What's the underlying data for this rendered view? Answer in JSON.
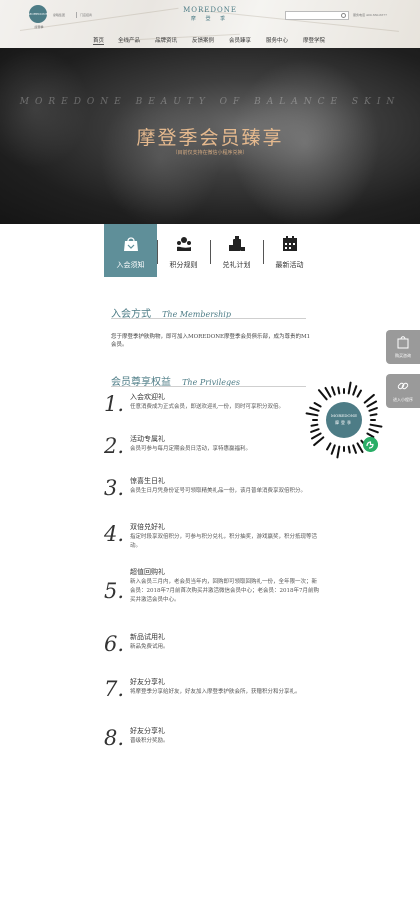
{
  "header": {
    "logo_text": "MOREDONE",
    "logo_sub": "摩登季",
    "link_1": "摩曦集团",
    "link_2": "门店招商",
    "brand_en": "MOREDONE",
    "brand_cn": "摩 登 季",
    "search_placeholder": "",
    "phone": "服务电话 400-660-6677"
  },
  "nav": {
    "items": [
      "首页",
      "全线产品",
      "品牌资讯",
      "反馈案例",
      "会员臻享",
      "服务中心",
      "摩登学院"
    ],
    "active_index": 0
  },
  "hero": {
    "watermark": "MOREDONE BEAUTY OF BALANCE SKIN",
    "title": "摩登季会员臻享",
    "subtitle": "（目前仅支持在微信小程序兑换）"
  },
  "tabs": [
    {
      "label": "入会须知",
      "icon": "shopping-bag-icon",
      "active": true
    },
    {
      "label": "积分规则",
      "icon": "coins-hand-icon",
      "active": false
    },
    {
      "label": "兑礼计划",
      "icon": "gift-bottle-icon",
      "active": false
    },
    {
      "label": "最新活动",
      "icon": "calendar-icon",
      "active": false
    }
  ],
  "membership": {
    "heading_cn": "入会方式",
    "heading_en": "The Membership",
    "text": "您于摩登季护肤购物，即可加入MOREDONE摩登季会员俱乐部，成为尊贵的M1会员。"
  },
  "privileges": {
    "heading_cn": "会员尊享权益",
    "heading_en": "The Privileges",
    "items": [
      {
        "num": "1.",
        "title": "入会欢迎礼",
        "desc": "任意消费成为正式会员，即送欢迎礼一份，同时可享积分双倍。"
      },
      {
        "num": "2.",
        "title": "活动专属礼",
        "desc": "会员可参与每月定期会员日活动，享特惠赢福利。"
      },
      {
        "num": "3.",
        "title": "惊喜生日礼",
        "desc": "会员生日月凭身份证号可领取精美礼品一份，该月普单消费享双倍积分。"
      },
      {
        "num": "4.",
        "title": "双倍兑好礼",
        "desc": "指定时段享双倍积分，可参与积分兑礼，积分抽奖，游戏赢奖，积分抵现等活动。"
      },
      {
        "num": "5.",
        "title": "超值回购礼",
        "desc": "新入会员三月内，老会员当年内，回购即可领取回购礼一份，全年限一次；新会员：2018年7月前首次购买并激活微信会员中心；老会员：2018年7月前购买并激活会员中心。"
      },
      {
        "num": "6.",
        "title": "新品试用礼",
        "desc": "新品免费试用。"
      },
      {
        "num": "7.",
        "title": "好友分享礼",
        "desc": "将摩登季分享给好友，好友加入摩登季护肤会所，获赠积分和分享礼。"
      },
      {
        "num": "8.",
        "title": "好友分享礼",
        "desc": "晋级积分奖励。"
      }
    ]
  },
  "float": {
    "btn_1": "购买咨询",
    "btn_2": "进入小程序"
  },
  "qr": {
    "center_en": "MOREDONE",
    "center_cn": "摩登季"
  },
  "colors": {
    "accent": "#4d7c86",
    "tab_active": "#5f8f99",
    "hero_gold": "#e5b98e",
    "float_bg": "#9a9a9a",
    "wechat_green": "#2aae67"
  }
}
